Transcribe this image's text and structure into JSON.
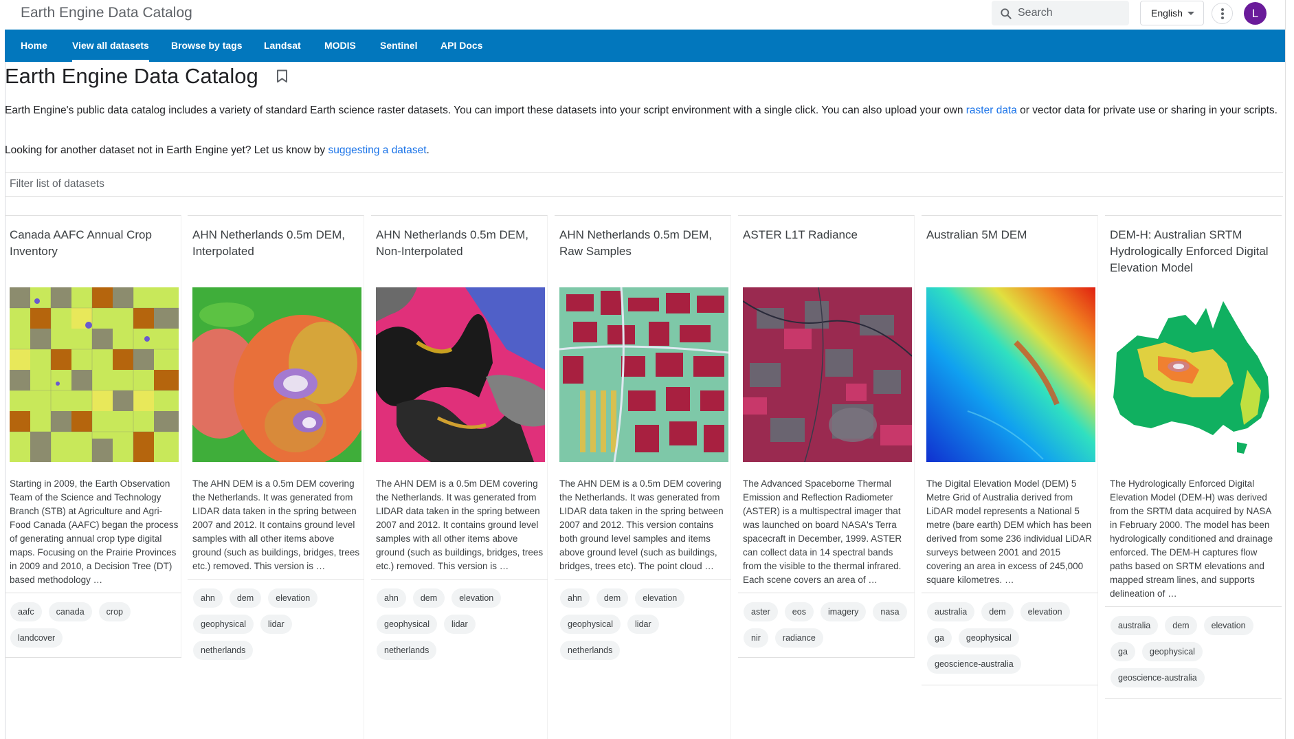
{
  "header": {
    "site_title": "Earth Engine Data Catalog",
    "search_placeholder": "Search",
    "language": "English",
    "avatar_letter": "L"
  },
  "nav": {
    "items": [
      "Home",
      "View all datasets",
      "Browse by tags",
      "Landsat",
      "MODIS",
      "Sentinel",
      "API Docs"
    ],
    "active": "View all datasets"
  },
  "page": {
    "title": "Earth Engine Data Catalog",
    "intro_before_link": "Earth Engine's public data catalog includes a variety of standard Earth science raster datasets. You can import these datasets into your script environment with a single click. You can also upload your own ",
    "intro_link": "raster data",
    "intro_after_link": " or vector data for private use or sharing in your scripts.",
    "suggest_before_link": "Looking for another dataset not in Earth Engine yet? Let us know by ",
    "suggest_link": "suggesting a dataset",
    "suggest_after_link": ".",
    "filter_placeholder": "Filter list of datasets"
  },
  "datasets": [
    {
      "title": "Canada AAFC Annual Crop Inventory",
      "description": "Starting in 2009, the Earth Observation Team of the Science and Technology Branch (STB) at Agriculture and Agri-Food Canada (AAFC) began the process of generating annual crop type digital maps. Focusing on the Prairie Provinces in 2009 and 2010, a Decision Tree (DT) based methodology …",
      "tags": [
        "aafc",
        "canada",
        "crop",
        "landcover"
      ]
    },
    {
      "title": "AHN Netherlands 0.5m DEM, Interpolated",
      "description": "The AHN DEM is a 0.5m DEM covering the Netherlands. It was generated from LIDAR data taken in the spring between 2007 and 2012. It contains ground level samples with all other items above ground (such as buildings, bridges, trees etc.) removed. This version is …",
      "tags": [
        "ahn",
        "dem",
        "elevation",
        "geophysical",
        "lidar",
        "netherlands"
      ]
    },
    {
      "title": "AHN Netherlands 0.5m DEM, Non-Interpolated",
      "description": "The AHN DEM is a 0.5m DEM covering the Netherlands. It was generated from LIDAR data taken in the spring between 2007 and 2012. It contains ground level samples with all other items above ground (such as buildings, bridges, trees etc.) removed. This version is …",
      "tags": [
        "ahn",
        "dem",
        "elevation",
        "geophysical",
        "lidar",
        "netherlands"
      ]
    },
    {
      "title": "AHN Netherlands 0.5m DEM, Raw Samples",
      "description": "The AHN DEM is a 0.5m DEM covering the Netherlands. It was generated from LIDAR data taken in the spring between 2007 and 2012. This version contains both ground level samples and items above ground level (such as buildings, bridges, trees etc). The point cloud …",
      "tags": [
        "ahn",
        "dem",
        "elevation",
        "geophysical",
        "lidar",
        "netherlands"
      ]
    },
    {
      "title": "ASTER L1T Radiance",
      "description": "The Advanced Spaceborne Thermal Emission and Reflection Radiometer (ASTER) is a multispectral imager that was launched on board NASA's Terra spacecraft in December, 1999. ASTER can collect data in 14 spectral bands from the visible to the thermal infrared. Each scene covers an area of …",
      "tags": [
        "aster",
        "eos",
        "imagery",
        "nasa",
        "nir",
        "radiance"
      ]
    },
    {
      "title": "Australian 5M DEM",
      "description": "The Digital Elevation Model (DEM) 5 Metre Grid of Australia derived from LiDAR model represents a National 5 metre (bare earth) DEM which has been derived from some 236 individual LiDAR surveys between 2001 and 2015 covering an area in excess of 245,000 square kilometres. …",
      "tags": [
        "australia",
        "dem",
        "elevation",
        "ga",
        "geophysical",
        "geoscience-australia"
      ]
    },
    {
      "title": "DEM-H: Australian SRTM Hydrologically Enforced Digital Elevation Model",
      "description": "The Hydrologically Enforced Digital Elevation Model (DEM-H) was derived from the SRTM data acquired by NASA in February 2000. The model has been hydrologically conditioned and drainage enforced. The DEM-H captures flow paths based on SRTM elevations and mapped stream lines, and supports delineation of …",
      "tags": [
        "australia",
        "dem",
        "elevation",
        "ga",
        "geophysical",
        "geoscience-australia"
      ]
    }
  ]
}
